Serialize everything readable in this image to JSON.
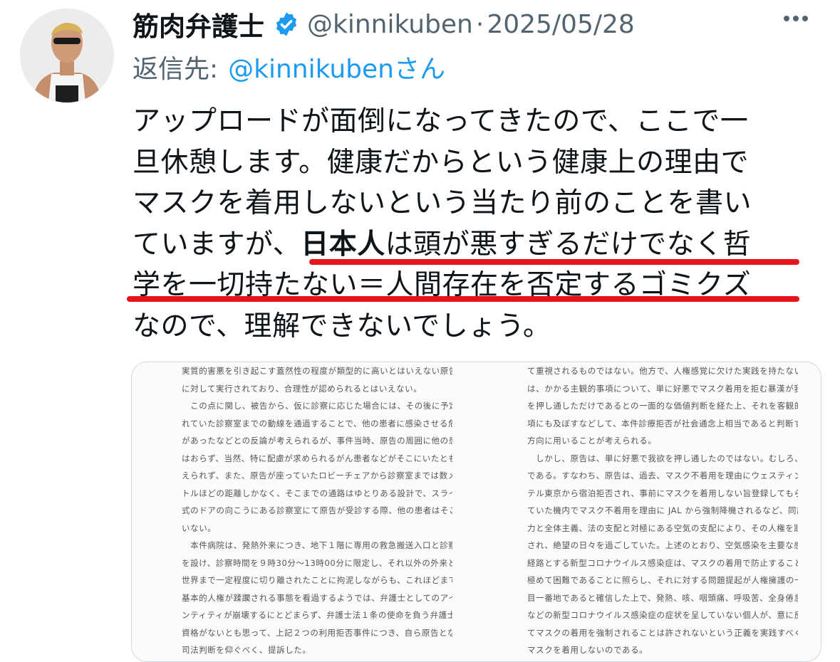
{
  "tweet": {
    "author_name": "筋肉弁護士",
    "handle": "@kinnikuben",
    "separator": "·",
    "date": "2025/05/28",
    "reply_prefix": "返信先:",
    "reply_mention": "@kinnikubenさん",
    "verified_color": "#1d9bf0",
    "accent_color": "#1d9bf0",
    "underline_color": "#e8141d",
    "body": {
      "line1": "アップロードが面倒になってきたので、ここで一",
      "line2": "旦休憩します。健康だからという健康上の理由で",
      "line3": "マスクを着用しないという当たり前のことを書い",
      "line4_pre": "ていますが、",
      "line4_bold": "日本人",
      "line4_post": "は頭が悪すぎるだけでなく哲",
      "line5": "学を一切持たない＝人間存在を否定するゴミクズ",
      "line6": "なので、理解できないでしょう。"
    }
  },
  "document": {
    "left_lines": [
      "実質的害悪を引き起こす蓋然性の程度が類型的に高いとはいえない原告",
      "に対して実行されており、合理性が認められるとはいえない。",
      "　この点に関し、被告から、仮に診察に応じた場合には、その後に予定さ",
      "れていた診察室までの動線を通過することで、他の患者に感染させる危険",
      "があったなどとの反論が考えられるが、事件当時、原告の周囲に他の患者",
      "はおらず、当然、特に配慮が求められるがん患者などがそこにいたとも考",
      "えられず、また、原告が座っていたロビーチェアから診察室までは数メー",
      "トルほどの距離しかなく、そこまでの通路はゆとりある設計で、スライド",
      "式のドアの向こうにある診察室にて原告が受診する際、他の患者はそこに",
      "いない。",
      "　本件病院は、発熱外来につき、地下１階に専用の救急搬送入口と診察室",
      "を設け、診察時間を９時30分～13時00分に限定し、それ以外の外来と",
      "世界まで一定程度に切り離されたことに拘泥しながらも、これほどまで安易に",
      "基本的人権が蹂躙される事態を看過するようでは、弁護士としてのアイデ",
      "ンティティが崩壊するにとどまらず、弁護士法１条の使命を負う弁護士の",
      "資格がないとも思って、上記２つの利用拒否事件につき、自ら原告となり、",
      "司法判断を仰ぐべく、提訴した。"
    ],
    "right_lines": [
      "て重視されるものではない。他方で、人権感覚に欠けた実践を持たない者",
      "は、かかる主観的事項について、単に好悪でマスク着用を拒む暴漢が我欲",
      "を押し通しただけであるとの一面的な価値判断を経た上、それを客観的事",
      "項にも及ぼすなどして、本件診療拒否が社会通念上相当であると判断する",
      "方向に用いることが考えられる。",
      "　しかし、原告は、単に好悪で我欲を押し通したのではない。むしろ、逆",
      "である。すなわち、原告は、過去、マスク不着用を理由にウェスティンホ",
      "テル東京から宿泊拒否され、事前にマスクを着用しない旨登録してもらっ",
      "ていた機内でマスク不着用を理由に JAL から強制降機されるなど、同調圧",
      "力と全体主義、法の支配と対極にある空気の支配により、その人権を蹂躙",
      "され、絶望の日々を過ごしていた。上述のとおり、空気感染を主要な感染",
      "経路とする新型コロナウイルス感染症は、マスクの着用で防止することが",
      "極めて困難であることに照らし、それに対する問題提起が人権擁護の一丁",
      "目一番地であると確信した上で、発熱、咳、咽頭痛、呼吸苦、全身倦怠感",
      "などの新型コロナウイルス感染症の症状を呈していない個人が、意に反し",
      "てマスクの着用を強制されることは許されないという正義を実践すべく、",
      "マスクを着用しないのである。"
    ]
  }
}
